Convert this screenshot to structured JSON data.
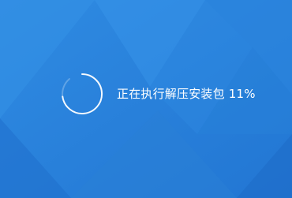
{
  "installer": {
    "status_message": "正在执行解压安装包",
    "progress_text": "11%",
    "progress": 0.11
  },
  "colors": {
    "background": "#2a84dc",
    "text": "#ffffff",
    "spinner": "#ffffff"
  },
  "icons": {
    "spinner": "loading-spinner-icon"
  }
}
